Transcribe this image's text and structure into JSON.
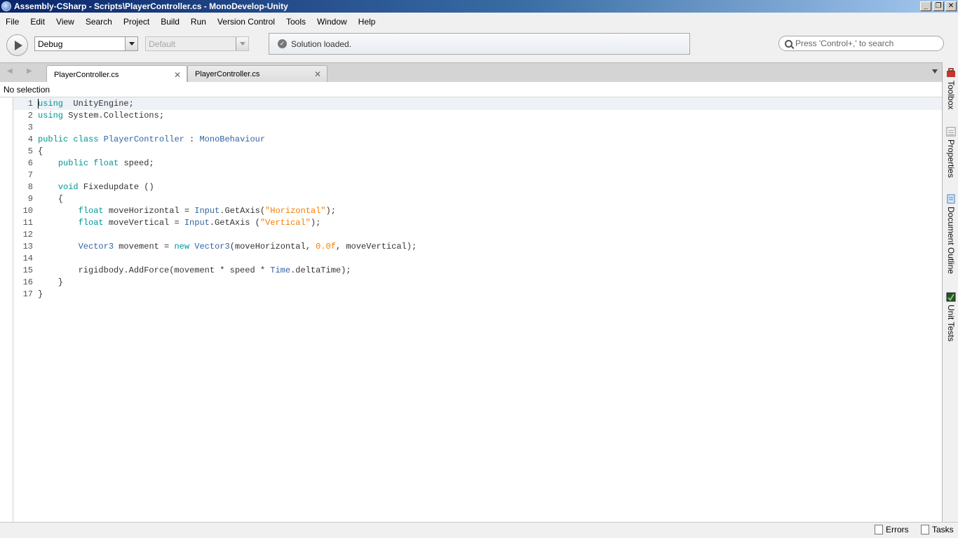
{
  "window": {
    "title": "Assembly-CSharp - Scripts\\PlayerController.cs - MonoDevelop-Unity",
    "controls": [
      "minimize-icon",
      "restore-icon",
      "close-icon"
    ]
  },
  "menubar": {
    "items": [
      "File",
      "Edit",
      "View",
      "Search",
      "Project",
      "Build",
      "Run",
      "Version Control",
      "Tools",
      "Window",
      "Help"
    ]
  },
  "toolbar": {
    "configuration": "Debug",
    "target": "Default",
    "status_message": "Solution loaded.",
    "search_placeholder": "Press 'Control+,' to search"
  },
  "tabs": [
    {
      "label": "PlayerController.cs",
      "active": true
    },
    {
      "label": "PlayerController.cs",
      "active": false
    }
  ],
  "pathbar": {
    "text": "No selection"
  },
  "editor": {
    "lines": [
      {
        "n": "1",
        "tokens": [
          [
            "kw",
            "using"
          ],
          [
            "",
            "  UnityEngine;"
          ]
        ]
      },
      {
        "n": "2",
        "tokens": [
          [
            "kw",
            "using"
          ],
          [
            "",
            " System.Collections;"
          ]
        ]
      },
      {
        "n": "3",
        "tokens": []
      },
      {
        "n": "4",
        "tokens": [
          [
            "kw",
            "public"
          ],
          [
            "",
            " "
          ],
          [
            "kw",
            "class"
          ],
          [
            "",
            " "
          ],
          [
            "ty",
            "PlayerController"
          ],
          [
            "",
            " : "
          ],
          [
            "ty",
            "MonoBehaviour"
          ]
        ]
      },
      {
        "n": "5",
        "tokens": [
          [
            "",
            "{"
          ]
        ]
      },
      {
        "n": "6",
        "tokens": [
          [
            "",
            "    "
          ],
          [
            "kw",
            "public"
          ],
          [
            "",
            " "
          ],
          [
            "kw",
            "float"
          ],
          [
            "",
            " speed;"
          ]
        ]
      },
      {
        "n": "7",
        "tokens": []
      },
      {
        "n": "8",
        "tokens": [
          [
            "",
            "    "
          ],
          [
            "kw",
            "void"
          ],
          [
            "",
            " Fixedupdate ()"
          ]
        ]
      },
      {
        "n": "9",
        "tokens": [
          [
            "",
            "    {"
          ]
        ]
      },
      {
        "n": "10",
        "tokens": [
          [
            "",
            "        "
          ],
          [
            "kw",
            "float"
          ],
          [
            "",
            " moveHorizontal = "
          ],
          [
            "ty",
            "Input"
          ],
          [
            "",
            ".GetAxis("
          ],
          [
            "st",
            "\"Horizontal\""
          ],
          [
            "",
            ");"
          ]
        ]
      },
      {
        "n": "11",
        "tokens": [
          [
            "",
            "        "
          ],
          [
            "kw",
            "float"
          ],
          [
            "",
            " moveVertical = "
          ],
          [
            "ty",
            "Input"
          ],
          [
            "",
            ".GetAxis ("
          ],
          [
            "st",
            "\"Vertical\""
          ],
          [
            "",
            ");"
          ]
        ]
      },
      {
        "n": "12",
        "tokens": []
      },
      {
        "n": "13",
        "tokens": [
          [
            "",
            "        "
          ],
          [
            "ty",
            "Vector3"
          ],
          [
            "",
            " movement = "
          ],
          [
            "kw",
            "new"
          ],
          [
            "",
            " "
          ],
          [
            "ty",
            "Vector3"
          ],
          [
            "",
            "(moveHorizontal, "
          ],
          [
            "nu",
            "0.0f"
          ],
          [
            "",
            ", moveVertical);"
          ]
        ]
      },
      {
        "n": "14",
        "tokens": []
      },
      {
        "n": "15",
        "tokens": [
          [
            "",
            "        rigidbody.AddForce(movement * speed * "
          ],
          [
            "ty",
            "Time"
          ],
          [
            "",
            ".deltaTime);"
          ]
        ]
      },
      {
        "n": "16",
        "tokens": [
          [
            "",
            "    }"
          ]
        ]
      },
      {
        "n": "17",
        "tokens": [
          [
            "",
            "}"
          ]
        ]
      }
    ],
    "current_line": 1
  },
  "rightdock": {
    "items": [
      {
        "label": "Toolbox",
        "icon": "toolbox-icon"
      },
      {
        "label": "Properties",
        "icon": "properties-icon"
      },
      {
        "label": "Document Outline",
        "icon": "document-outline-icon"
      },
      {
        "label": "Unit Tests",
        "icon": "unit-tests-icon"
      }
    ]
  },
  "statusbar": {
    "errors_label": "Errors",
    "tasks_label": "Tasks"
  }
}
